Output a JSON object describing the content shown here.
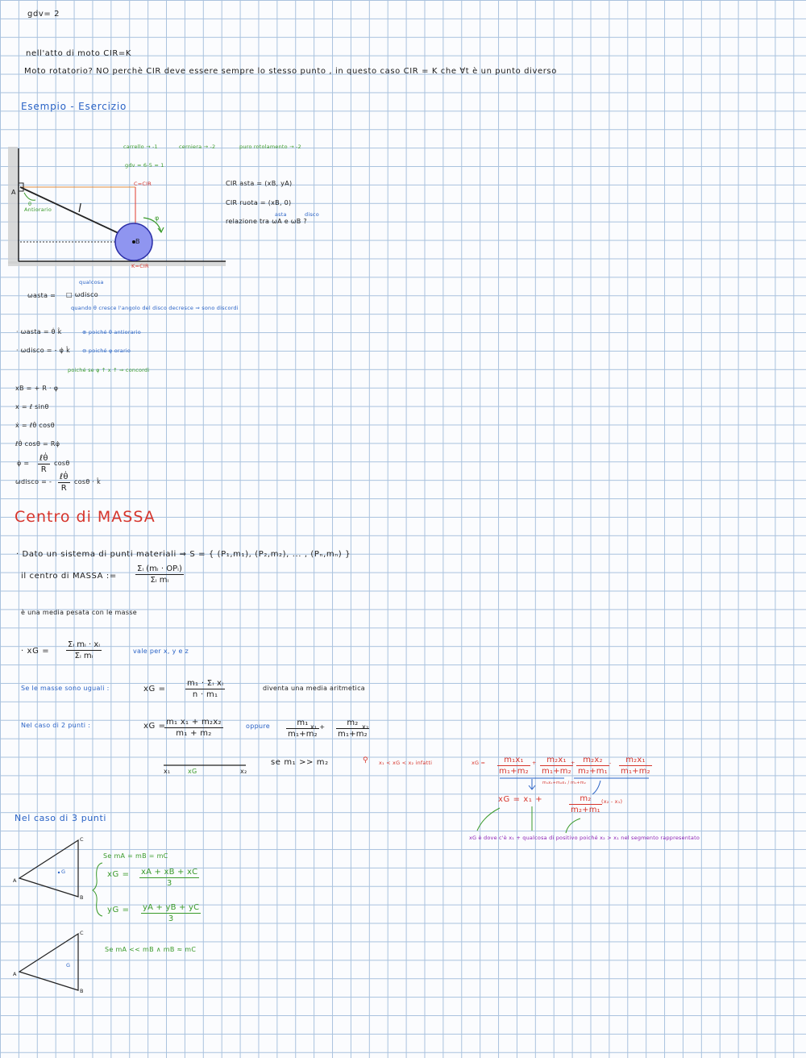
{
  "lines": {
    "gdv": "gdv= 2",
    "atto_moto": "nell'atto di moto   CIR=K",
    "moto_rotatorio": "Moto rotatorio? NO perchè CIR deve essere sempre lo stesso punto , in questo caso CIR = K che ∀t è un punto diverso"
  },
  "esempio": {
    "title": "Esempio - Esercizio",
    "top_notes": {
      "carrello": "carrello → -1",
      "cerniera": "cerniera → -2",
      "puro_rotolamento": "puro rotolamento → -2",
      "gdv": "gdv = 6-5 = 1"
    },
    "labels": {
      "c_cir": "C=CIR",
      "k_cir": "K=CIR",
      "A": "A",
      "B": "B",
      "l": "l",
      "theta": "θ",
      "antiorario": "Antiorario",
      "phi": "φ"
    },
    "right_notes": {
      "cir_asta": "CIR asta = (xB, yA)",
      "cir_ruota": "CIR ruota = (xB, 0)",
      "relazione": "relazione tra ωA e ωB ?",
      "asta_small": "asta",
      "disco_small": "disco"
    },
    "omega_line": {
      "lhs": "ωasta =",
      "rhs": "□ ωdisco",
      "qualcosa": "qualcosa",
      "note": "quando θ cresce l'angolo del disco decresce ⇒ sono discordi"
    },
    "eq1": {
      "text": "· ωasta = θ̇ k̂",
      "note": "⊕ poiché θ antiorario"
    },
    "eq2": {
      "text": "· ωdisco = - φ̇ k̂",
      "note": "⊖ poiché φ orario"
    },
    "poiche_note": "poiché se φ ↑  x ↑ ⇒ concordi",
    "eqs": [
      "xB =   + R · φ",
      "x = ℓ sinθ",
      "ẋ = ℓθ̇ cosθ",
      "ℓθ̇ cosθ = Rφ̇",
      "φ̇ =",
      "ωdisco = -"
    ],
    "frac_phi": {
      "num": "ℓθ̇",
      "den": "R",
      "after": "cosθ"
    },
    "frac_omega": {
      "num": "ℓθ̇",
      "den": "R",
      "after": "cosθ · k̂"
    }
  },
  "centro": {
    "title": "Centro di MASSA",
    "dato": "· Dato un sistema di punti materiali ⇒ S = { (P₁,m₁), (P₂,m₂), ... , (Pₙ,mₙ) }",
    "def_lhs": "il centro di MASSA :=",
    "def_num": "Σᵢ (mᵢ · OPᵢ)",
    "def_den": "Σᵢ mᵢ",
    "media": "è una media pesata con le masse",
    "xg_lhs": "· xG =",
    "xg_num": "Σᵢ mᵢ · xᵢ",
    "xg_den": "Σᵢ mᵢ",
    "vale": "vale per x, y e z",
    "uguali_lhs": "Se le masse sono uguali :",
    "uguali_xg": "xG =",
    "uguali_num": "m₁ · Σᵢ xᵢ",
    "uguali_den": "n · m₁",
    "uguali_after": "diventa una media aritmetica",
    "due_lhs": "Nel caso di 2 punti :",
    "due_xg": "xG =",
    "due_num": "m₁ x₁ + m₂x₂",
    "due_den": "m₁ + m₂",
    "oppure": "oppure",
    "opp_a_num": "m₁",
    "opp_a_den": "m₁+m₂",
    "opp_x1": "x₁ +",
    "opp_b_num": "m₂",
    "opp_b_den": "m₁+m₂",
    "opp_x2": "x₂",
    "seg_x1": "x₁",
    "seg_xg": "xG",
    "seg_x2": "x₂",
    "se_m1": "se  m₁ >> m₂",
    "red_ineq": "x₁ < xG < x₂  infatti",
    "red_xg": "xG =",
    "red_f1_num": "m₁x₁",
    "red_f1_den": "m₁+m₂",
    "red_f2_num": "m₂x₁",
    "red_f2_den": "m₁+m₂",
    "red_f3_num": "m₂x₂",
    "red_f3_den": "m₂+m₁",
    "red_f4_num": "m₂x₁",
    "red_f4_den": "m₁+m₂",
    "red_small": "m₁x₁+m₂x₁ / m₁+m₂",
    "final_lhs": "xG = x₁ +",
    "final_num": "m₂",
    "final_den": "m₂+m₁",
    "final_after": "(x₂ - x₁)",
    "purple_note": "xG è dove c'è x₁ + qualcosa di positivo poiché x₂ > x₁ nel segmento rappresentato"
  },
  "tre_punti": {
    "title": "Nel caso di 3 punti",
    "tri1": {
      "A": "A",
      "B": "B",
      "C": "C",
      "G": "G"
    },
    "se_uguali": "Se mA = mB = mC",
    "xg_lhs": "xG =",
    "xg_num": "xA + xB + xC",
    "xg_den": "3",
    "yg_lhs": "yG =",
    "yg_num": "yA + yB + yC",
    "yg_den": "3",
    "tri2": {
      "A": "A",
      "B": "B",
      "C": "C",
      "G": "G"
    },
    "se_diverse": "Se  mA << mB  ∧  mB ≈ mC"
  }
}
